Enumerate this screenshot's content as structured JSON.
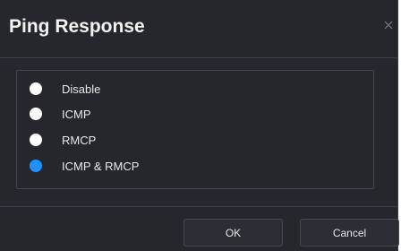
{
  "dialog": {
    "title": "Ping Response",
    "close_icon": "close-icon"
  },
  "options": [
    {
      "label": "Disable",
      "selected": false
    },
    {
      "label": "ICMP",
      "selected": false
    },
    {
      "label": "RMCP",
      "selected": false
    },
    {
      "label": "ICMP & RMCP",
      "selected": true
    }
  ],
  "buttons": {
    "ok_label": "OK",
    "cancel_label": "Cancel"
  },
  "colors": {
    "dialog_background": "#25272d",
    "selected_radio": "#1e90ff",
    "unselected_radio": "#ffffff"
  }
}
